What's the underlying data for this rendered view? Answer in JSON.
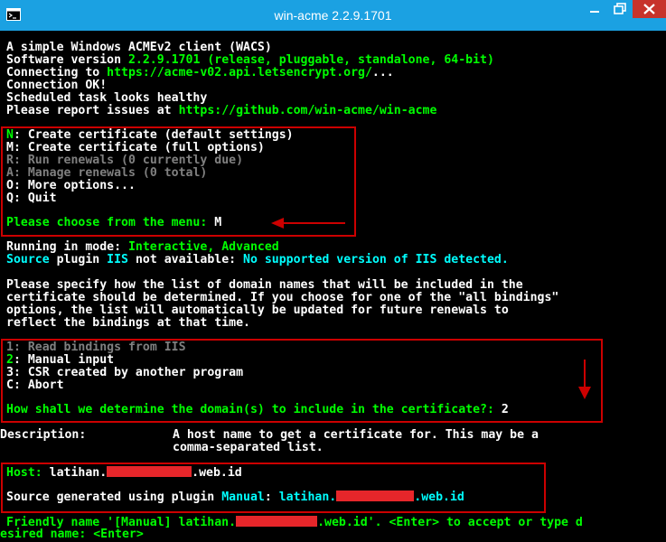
{
  "window": {
    "title": "win-acme 2.2.9.1701"
  },
  "header": {
    "line1": "A simple Windows ACMEv2 client (WACS)",
    "software_label": "Software version ",
    "software_version": "2.2.9.1701",
    "software_build": " (release, pluggable, standalone, 64-bit)",
    "connecting_label": "Connecting to ",
    "acme_url": "https://acme-v02.api.letsencrypt.org/",
    "connecting_suffix": "...",
    "connection_ok": "Connection OK!",
    "scheduled_task": "Scheduled task looks healthy",
    "report_label": "Please report issues at ",
    "report_url": "https://github.com/win-acme/win-acme"
  },
  "main_menu": {
    "items": [
      {
        "key": "N",
        "sep": ": ",
        "text": "Create certificate (default settings)",
        "enabled": true
      },
      {
        "key": "M",
        "sep": ": ",
        "text": "Create certificate (full options)",
        "enabled": true
      },
      {
        "key": "R",
        "sep": ": ",
        "text": "Run renewals (0 currently due)",
        "enabled": false
      },
      {
        "key": "A",
        "sep": ": ",
        "text": "Manage renewals (0 total)",
        "enabled": false
      },
      {
        "key": "O",
        "sep": ": ",
        "text": "More options...",
        "enabled": true
      },
      {
        "key": "Q",
        "sep": ": ",
        "text": "Quit",
        "enabled": true
      }
    ],
    "prompt": "Please choose from the menu: ",
    "answer": "M"
  },
  "mode": {
    "label": "Running in mode: ",
    "value": "Interactive, Advanced",
    "source_word": "Source",
    "plugin_word": " plugin ",
    "iis_word": "IIS",
    "not_available": " not available: ",
    "reason": "No supported version of IIS detected."
  },
  "explanation": [
    "Please specify how the list of domain names that will be included in the",
    "certificate should be determined. If you choose for one of the \"all bindings\"",
    "options, the list will automatically be updated for future renewals to",
    "reflect the bindings at that time."
  ],
  "source_menu": {
    "items": [
      {
        "key": "1",
        "sep": ": ",
        "text": "Read bindings from IIS",
        "enabled": false
      },
      {
        "key": "2",
        "sep": ": ",
        "text": "Manual input",
        "enabled": true
      },
      {
        "key": "3",
        "sep": ": ",
        "text": "CSR created by another program",
        "enabled": true
      },
      {
        "key": "C",
        "sep": ": ",
        "text": "Abort",
        "enabled": true
      }
    ],
    "prompt": "How shall we determine the domain(s) to include in the certificate?: ",
    "answer": "2"
  },
  "description": {
    "label": "Description:",
    "line1": "A host name to get a certificate for. This may be a",
    "line2": "comma-separated list."
  },
  "host": {
    "label": "Host: ",
    "prefix": "latihan.",
    "suffix": ".web.id"
  },
  "source_generated": {
    "label": "Source generated using plugin ",
    "plugin": "Manual",
    "colon": ": ",
    "prefix": "latihan.",
    "suffix": ".web.id"
  },
  "friendly": {
    "label": "Friendly name '[Manual] latihan.",
    "suffix": ".web.id'. <Enter> to accept or type d",
    "line2": "esired name: <Enter>"
  },
  "colors": {
    "titlebar": "#1ba1e2",
    "close_button": "#c7332b",
    "console_bg": "#000000",
    "highlight_box": "#cc0000",
    "green": "#00ff00",
    "cyan": "#00ffff",
    "gray": "#808080",
    "redaction": "#e6262a"
  },
  "icons": [
    "app-icon",
    "minimize-icon",
    "maximize-icon",
    "close-icon",
    "arrow-left-icon",
    "arrow-down-icon"
  ]
}
